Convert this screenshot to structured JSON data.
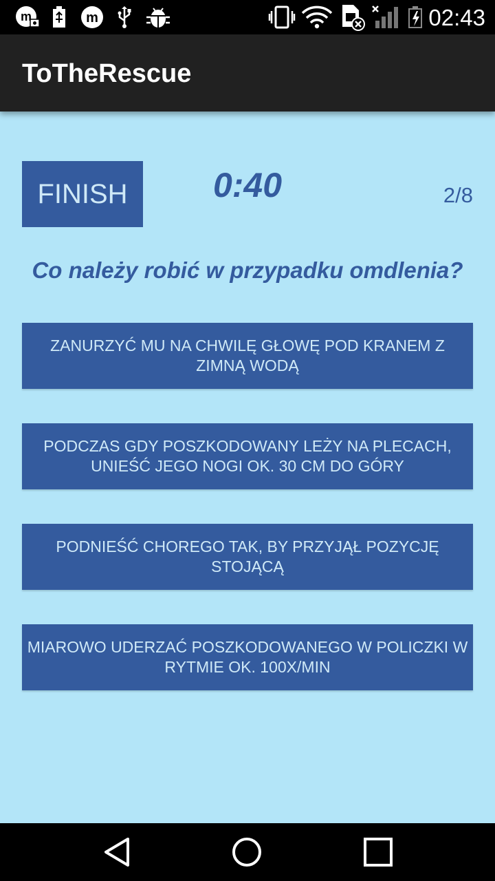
{
  "status_bar": {
    "time": "02:43",
    "icons": [
      "m-camera-icon",
      "battery-usb-icon",
      "m-icon",
      "usb-icon",
      "android-debug-icon",
      "vibrate-icon",
      "wifi-icon",
      "sim-error-icon",
      "signal-icon",
      "battery-charging-icon"
    ]
  },
  "app_bar": {
    "title": "ToTheRescue"
  },
  "quiz": {
    "finish_label": "FINISH",
    "timer": "0:40",
    "progress": "2/8",
    "question": "Co należy robić w przypadku omdlenia?",
    "answers": [
      "ZANURZYĆ MU NA CHWILĘ GŁOWĘ POD KRANEM Z ZIMNĄ WODĄ",
      "PODCZAS GDY POSZKODOWANY LEŻY NA PLECACH, UNIEŚĆ JEGO NOGI OK. 30 CM DO GÓRY",
      "PODNIEŚĆ CHOREGO TAK, BY PRZYJĄŁ POZYCJĘ STOJĄCĄ",
      "MIAROWO UDERZAĆ POSZKODOWANEGO W POLICZKI W RYTMIE OK. 100X/MIN"
    ]
  },
  "nav_bar": {
    "icons": [
      "back-icon",
      "home-icon",
      "recents-icon"
    ]
  },
  "colors": {
    "background": "#b3e5f8",
    "button": "#345b9e",
    "button_text": "#cfe9f7",
    "app_bar": "#212121"
  }
}
